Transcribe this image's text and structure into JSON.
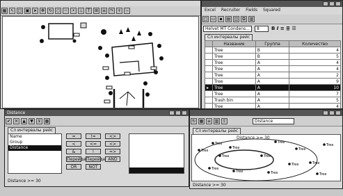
{
  "map_window": {
    "toolbar_icons": [
      "grid-icon",
      "cursor-icon",
      "box-icon",
      "select-icon",
      "arrow-icon",
      "move-icon",
      "rotate-icon",
      "zoom-icon",
      "line-icon",
      "point-icon",
      "measure-icon",
      "text-icon",
      "grid2-icon",
      "layer-icon",
      "redo-icon",
      "zoom-in-icon",
      "zoom-out-icon"
    ]
  },
  "table_window": {
    "title": "",
    "menu": [
      "Excel",
      "Recruiter",
      "Fields",
      "Squared"
    ],
    "toolbar_icons": [
      "new-icon",
      "open-icon",
      "save-icon",
      "print-icon",
      "preview-icon",
      "copy-icon",
      "paste-icon"
    ],
    "font_value": "Helvet MT Condens...",
    "size_value": "8",
    "tab_label": "Сл интервалы рейс",
    "columns": [
      "Название",
      "Группа",
      "Количество"
    ],
    "rows": [
      {
        "name": "Tree",
        "group": "B",
        "value": "4"
      },
      {
        "name": "Tree",
        "group": "B",
        "value": "5"
      },
      {
        "name": "Tree",
        "group": "A",
        "value": "4"
      },
      {
        "name": "Tree",
        "group": "A",
        "value": "4"
      },
      {
        "name": "Tree",
        "group": "A",
        "value": "2"
      },
      {
        "name": "Tree",
        "group": "A",
        "value": "9"
      },
      {
        "name": "Tree",
        "group": "A",
        "value": "10"
      },
      {
        "name": "Tree",
        "group": "A",
        "value": "7"
      },
      {
        "name": "Trash bin",
        "group": "A",
        "value": "5"
      },
      {
        "name": "Tree",
        "group": "A",
        "value": "4"
      }
    ],
    "selected_row": 6
  },
  "calc_window": {
    "title": "Distance",
    "tab_label": "Сл интервалы рейс",
    "list_items": [
      "Name",
      "Group",
      "Distance"
    ],
    "selected_item": 2,
    "buttons": [
      "=",
      "!=",
      "<>",
      "<",
      "<=",
      "<>",
      "&",
      "!",
      "=>",
      "Перейдет",
      "Перейдет",
      "AND",
      "OR",
      "NOT"
    ],
    "status_text": "Distance >= 30"
  },
  "cluster_window": {
    "title": "",
    "dropdown_value": "Distance",
    "tab_label": "Сл интервалы рейс",
    "filter_text": "Distance >= 30",
    "status_text": "Distance >= 30",
    "point_labels": [
      "Tree",
      "Tree",
      "Tree",
      "Tree",
      "Tree",
      "Tree",
      "Tree",
      "Tree",
      "Tree",
      "Tree",
      "Tree",
      "Tree",
      "Tree",
      "Tree"
    ]
  }
}
